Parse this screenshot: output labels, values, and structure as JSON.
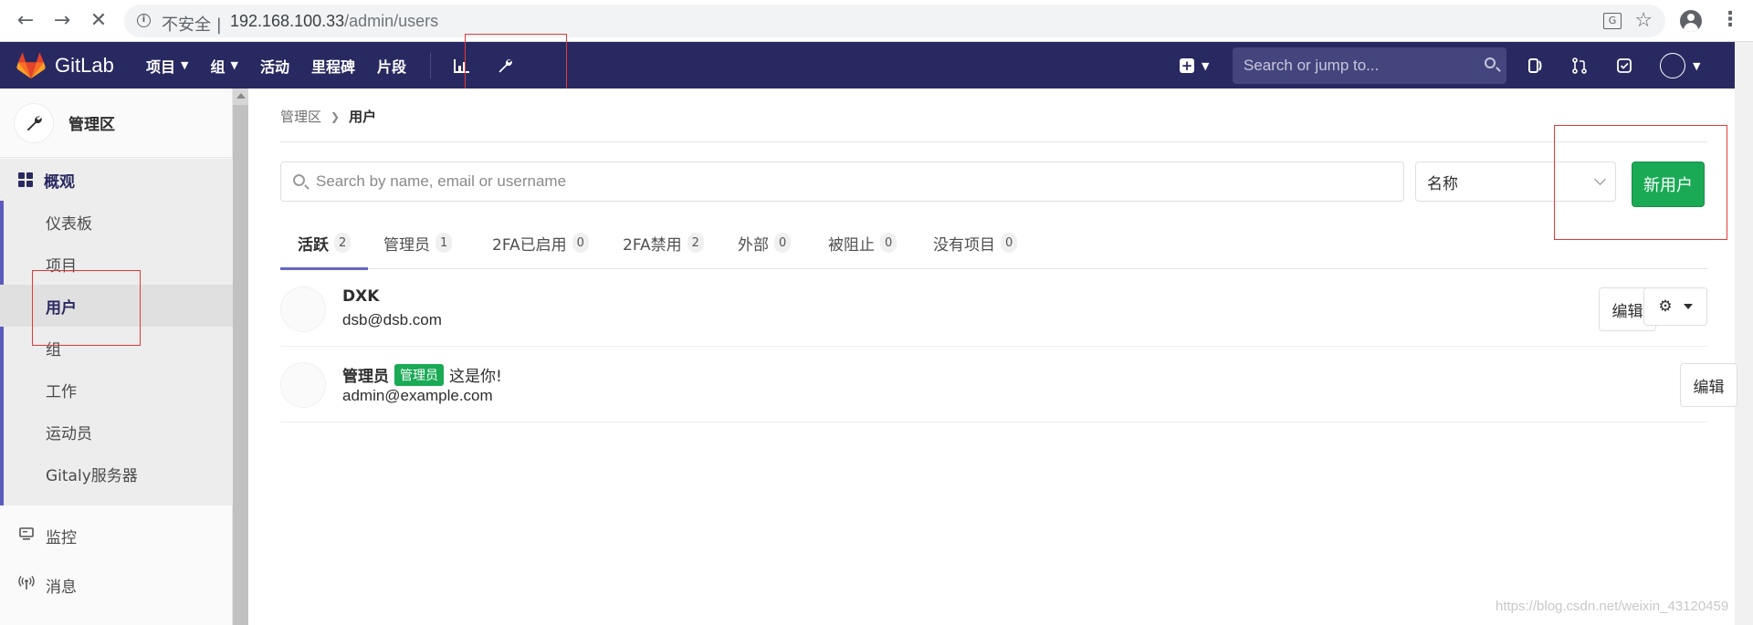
{
  "browser": {
    "insecure_label": "不安全 |",
    "url_host": "192.168.100.33",
    "url_path": "/admin/users",
    "icons": [
      "back-arrow-icon",
      "forward-arrow-icon",
      "stop-loading-icon",
      "info-icon",
      "translate-icon",
      "star-icon",
      "account-icon",
      "kebab-menu-icon"
    ]
  },
  "navbar": {
    "brand": "GitLab",
    "links": [
      {
        "label": "项目",
        "dropdown": true
      },
      {
        "label": "组",
        "dropdown": true
      },
      {
        "label": "活动",
        "dropdown": false
      },
      {
        "label": "里程碑",
        "dropdown": false
      },
      {
        "label": "片段",
        "dropdown": false
      }
    ],
    "search_placeholder": "Search or jump to...",
    "background": "#292961"
  },
  "sidebar": {
    "title": "管理区",
    "overview": {
      "label": "概观",
      "items": [
        {
          "label": "仪表板",
          "active": false
        },
        {
          "label": "项目",
          "active": false
        },
        {
          "label": "用户",
          "active": true
        },
        {
          "label": "组",
          "active": false
        },
        {
          "label": "工作",
          "active": false
        },
        {
          "label": "运动员",
          "active": false
        },
        {
          "label": "Gitaly服务器",
          "active": false
        }
      ]
    },
    "items": [
      {
        "label": "监控",
        "icon": "monitor-icon"
      },
      {
        "label": "消息",
        "icon": "broadcast-icon"
      }
    ]
  },
  "main": {
    "breadcrumb": {
      "parent": "管理区",
      "current": "用户"
    },
    "search_placeholder": "Search by name, email or username",
    "sort_value": "名称",
    "new_user_label": "新用户",
    "tabs": [
      {
        "label": "活跃",
        "count": "2",
        "active": true
      },
      {
        "label": "管理员",
        "count": "1",
        "active": false
      },
      {
        "label": "2FA已启用",
        "count": "0",
        "active": false
      },
      {
        "label": "2FA禁用",
        "count": "2",
        "active": false
      },
      {
        "label": "外部",
        "count": "0",
        "active": false
      },
      {
        "label": "被阻止",
        "count": "0",
        "active": false
      },
      {
        "label": "没有项目",
        "count": "0",
        "active": false
      }
    ],
    "users": [
      {
        "name": "DXK",
        "email": "dsb@dsb.com",
        "badge": "",
        "you": "",
        "edit_label": "编辑",
        "has_settings": true
      },
      {
        "name": "管理员",
        "email": "admin@example.com",
        "badge": "管理员",
        "you": "这是你!",
        "edit_label": "编辑",
        "has_settings": false
      }
    ],
    "accent_color": "#1aaa55"
  },
  "watermark": "https://blog.csdn.net/weixin_43120459"
}
